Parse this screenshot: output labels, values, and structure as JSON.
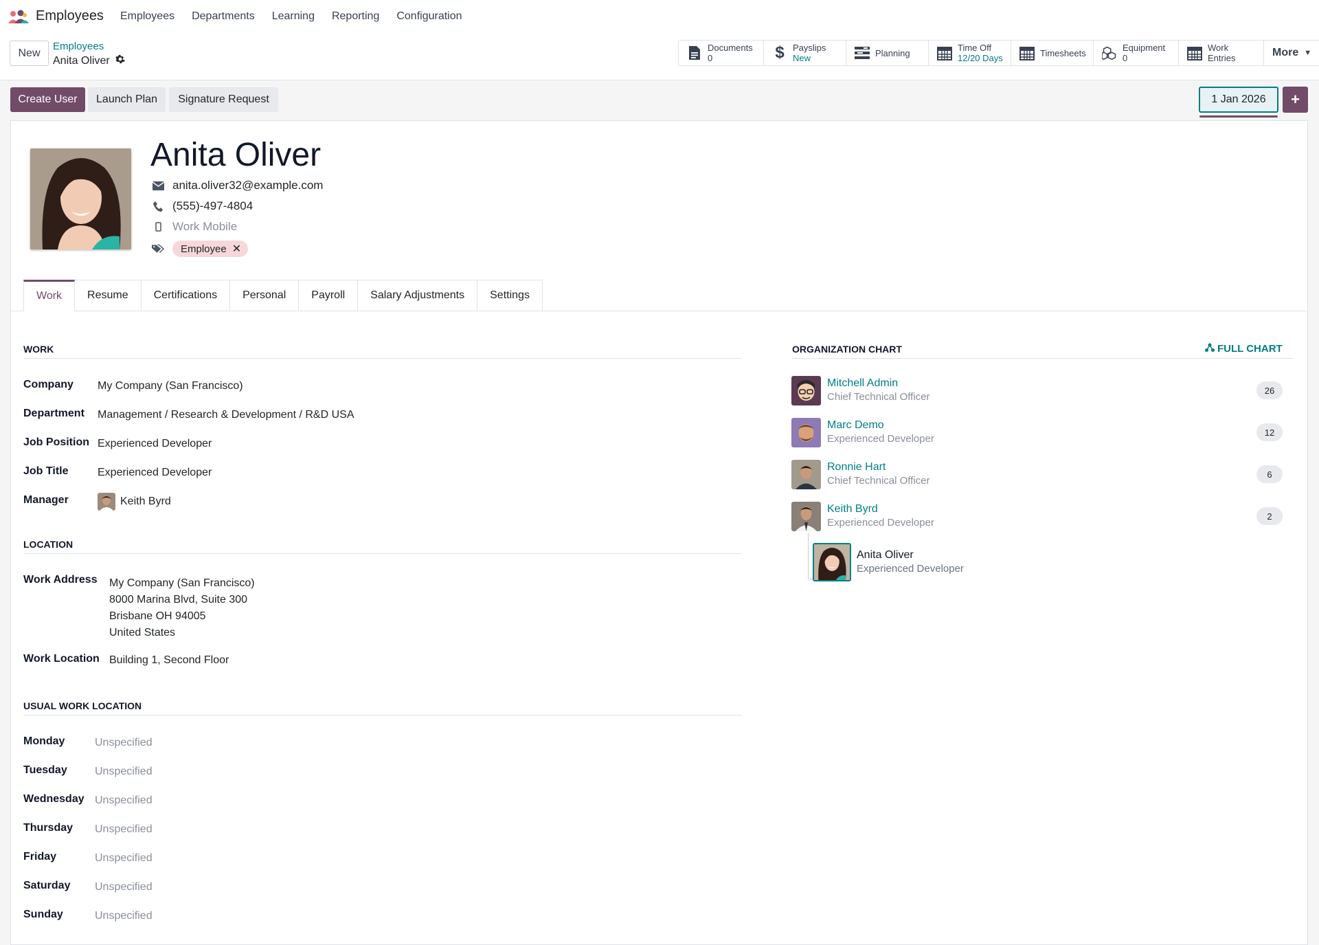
{
  "navbar": {
    "app_name": "Employees",
    "menu": [
      "Employees",
      "Departments",
      "Learning",
      "Reporting",
      "Configuration"
    ]
  },
  "control": {
    "new_label": "New",
    "breadcrumb_parent": "Employees",
    "breadcrumb_current": "Anita Oliver",
    "smart_buttons": [
      {
        "label": "Documents",
        "sub": "0",
        "icon": "document-icon"
      },
      {
        "label": "Payslips",
        "sub": "New",
        "icon": "dollar-icon"
      },
      {
        "label": "Planning",
        "sub": "",
        "icon": "planning-icon"
      },
      {
        "label": "Time Off",
        "sub": "12/20 Days",
        "icon": "calendar-icon"
      },
      {
        "label": "Timesheets",
        "sub": "",
        "icon": "calendar-icon"
      },
      {
        "label": "Equipment",
        "sub": "0",
        "icon": "cubes-icon"
      },
      {
        "label": "Work Entries",
        "sub": "",
        "icon": "calendar-icon"
      }
    ],
    "more_label": "More"
  },
  "actions": {
    "create_user": "Create User",
    "launch_plan": "Launch Plan",
    "signature_request": "Signature Request",
    "date": "1 Jan 2026",
    "plus": "+"
  },
  "employee": {
    "name": "Anita Oliver",
    "email": "anita.oliver32@example.com",
    "phone": "(555)-497-4804",
    "mobile_placeholder": "Work Mobile",
    "tag": "Employee"
  },
  "tabs": [
    "Work",
    "Resume",
    "Certifications",
    "Personal",
    "Payroll",
    "Salary Adjustments",
    "Settings"
  ],
  "work": {
    "title": "WORK",
    "fields": [
      {
        "label": "Company",
        "value": "My Company (San Francisco)"
      },
      {
        "label": "Department",
        "value": "Management / Research & Development / R&D USA"
      },
      {
        "label": "Job Position",
        "value": "Experienced Developer"
      },
      {
        "label": "Job Title",
        "value": "Experienced Developer"
      },
      {
        "label": "Manager",
        "value": "Keith Byrd"
      }
    ]
  },
  "location": {
    "title": "LOCATION",
    "address_label": "Work Address",
    "address_lines": [
      "My Company (San Francisco)",
      "8000 Marina Blvd, Suite 300",
      "Brisbane OH 94005",
      "United States"
    ],
    "work_location_label": "Work Location",
    "work_location": "Building 1, Second Floor"
  },
  "usual": {
    "title": "USUAL WORK LOCATION",
    "days": [
      {
        "day": "Monday",
        "value": "Unspecified"
      },
      {
        "day": "Tuesday",
        "value": "Unspecified"
      },
      {
        "day": "Wednesday",
        "value": "Unspecified"
      },
      {
        "day": "Thursday",
        "value": "Unspecified"
      },
      {
        "day": "Friday",
        "value": "Unspecified"
      },
      {
        "day": "Saturday",
        "value": "Unspecified"
      },
      {
        "day": "Sunday",
        "value": "Unspecified"
      }
    ]
  },
  "org": {
    "title": "ORGANIZATION CHART",
    "full_chart": "FULL CHART",
    "people": [
      {
        "name": "Mitchell Admin",
        "job": "Chief Technical Officer",
        "count": "26"
      },
      {
        "name": "Marc Demo",
        "job": "Experienced Developer",
        "count": "12"
      },
      {
        "name": "Ronnie Hart",
        "job": "Chief Technical Officer",
        "count": "6"
      },
      {
        "name": "Keith Byrd",
        "job": "Experienced Developer",
        "count": "2"
      }
    ],
    "self": {
      "name": "Anita Oliver",
      "job": "Experienced Developer"
    }
  },
  "colors": {
    "primary": "#714b67",
    "link": "#017e84",
    "tag_bg": "#f8d7da"
  }
}
